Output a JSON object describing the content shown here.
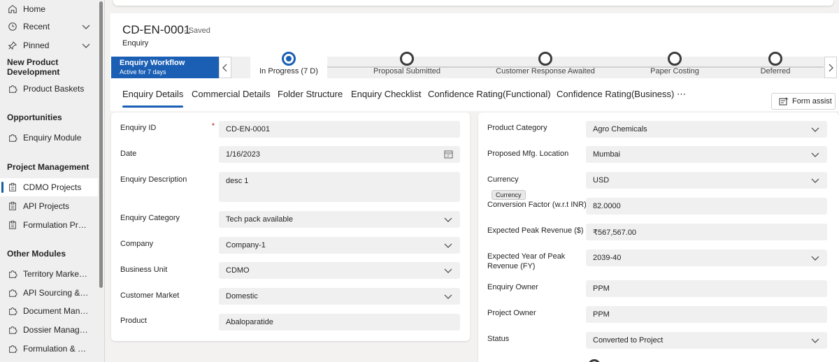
{
  "sidebar": {
    "items": [
      {
        "label": "Home",
        "icon": "home-icon"
      },
      {
        "label": "Recent",
        "icon": "clock-icon"
      },
      {
        "label": "Pinned",
        "icon": "pin-icon"
      }
    ],
    "new_product_heading": "New Product Development",
    "product_baskets": "Product Baskets",
    "opportunities_heading": "Opportunities",
    "enquiry_module": "Enquiry Module",
    "project_mgmt_heading": "Project Management",
    "cdmo_projects": "CDMO Projects",
    "api_projects": "API Projects",
    "formulation_projects": "Formulation Proje...",
    "other_modules_heading": "Other Modules",
    "territory_market": "Territory Market P...",
    "api_sourcing": "API Sourcing & V...",
    "document_manag": "Document Manag...",
    "dossier_management": "Dossier Managem...",
    "formulation_st": "Formulation & St..."
  },
  "record": {
    "title": "CD-EN-0001",
    "status": "- Saved",
    "entity": "Enquiry"
  },
  "bpf": {
    "flyout_title": "Enquiry Workflow",
    "flyout_sub": "Active for 7 days",
    "stages": [
      {
        "label": "In Progress  (7 D)",
        "active": true
      },
      {
        "label": "Proposal Submitted",
        "active": false
      },
      {
        "label": "Customer Response Awaited",
        "active": false
      },
      {
        "label": "Paper Costing",
        "active": false
      },
      {
        "label": "Deferred",
        "active": false
      }
    ]
  },
  "tabs": [
    "Enquiry Details",
    "Commercial Details",
    "Folder Structure",
    "Enquiry Checklist",
    "Confidence Rating(Functional)",
    "Confidence Rating(Business)",
    "⋯"
  ],
  "form_assist": "Form assist",
  "left_fields": [
    {
      "label": "Enquiry ID",
      "value": "CD-EN-0001",
      "required": true,
      "kind": "text"
    },
    {
      "label": "Date",
      "value": "1/16/2023",
      "kind": "date"
    },
    {
      "label": "Enquiry Description",
      "value": "desc 1",
      "kind": "multiline"
    },
    {
      "label": "Enquiry Category",
      "value": "Tech pack available",
      "kind": "select"
    },
    {
      "label": "Company",
      "value": "Company-1",
      "kind": "select"
    },
    {
      "label": "Business Unit",
      "value": "CDMO",
      "kind": "select"
    },
    {
      "label": "Customer Market",
      "value": "Domestic",
      "kind": "select"
    },
    {
      "label": "Product",
      "value": "Abaloparatide",
      "kind": "text"
    }
  ],
  "right_fields": [
    {
      "label": "Product Category",
      "value": "Agro Chemicals",
      "kind": "select"
    },
    {
      "label": "Proposed Mfg. Location",
      "value": "Mumbai",
      "kind": "select"
    },
    {
      "label": "Currency",
      "value": "USD",
      "kind": "select"
    },
    {
      "label": "Conversion Factor (w.r.t INR)",
      "value": "82.0000",
      "kind": "text"
    },
    {
      "label": "Expected Peak Revenue ($)",
      "value": "₹567,567.00",
      "kind": "text"
    },
    {
      "label": "Expected Year of Peak Revenue (FY)",
      "value": "2039-40",
      "kind": "select"
    },
    {
      "label": "Enquiry Owner",
      "value": "PPM",
      "kind": "text"
    },
    {
      "label": "Project Owner",
      "value": "PPM",
      "kind": "text"
    },
    {
      "label": "Status",
      "value": "Converted to Project",
      "kind": "select"
    }
  ],
  "tooltip": "Currency",
  "required_mark": "*",
  "colors": {
    "accent": "#1b5fb5",
    "bpf_flyout": "#1b5fb5",
    "field_bg": "#f0f0f0"
  }
}
